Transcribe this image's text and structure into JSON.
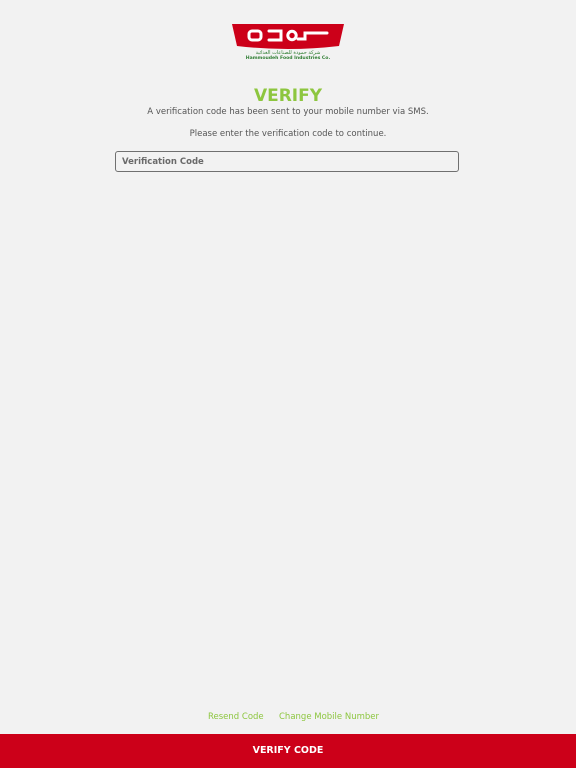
{
  "logo": {
    "arabic_subtitle": "شركة حمودة للصناعات الغذائية",
    "english_subtitle": "Hammoudeh Food Industries Co."
  },
  "header": {
    "title": "VERIFY"
  },
  "messages": {
    "sent_notice": "A verification code has been sent to your mobile number via SMS.",
    "instruction": "Please enter the verification code to continue."
  },
  "form": {
    "code_placeholder": "Verification Code"
  },
  "footer_links": {
    "resend": "Resend Code",
    "change_number": "Change Mobile Number"
  },
  "actions": {
    "verify_label": "VERIFY CODE"
  },
  "colors": {
    "brand_red": "#cc0019",
    "accent_green": "#8dc63f",
    "background": "#f2f2f2"
  }
}
